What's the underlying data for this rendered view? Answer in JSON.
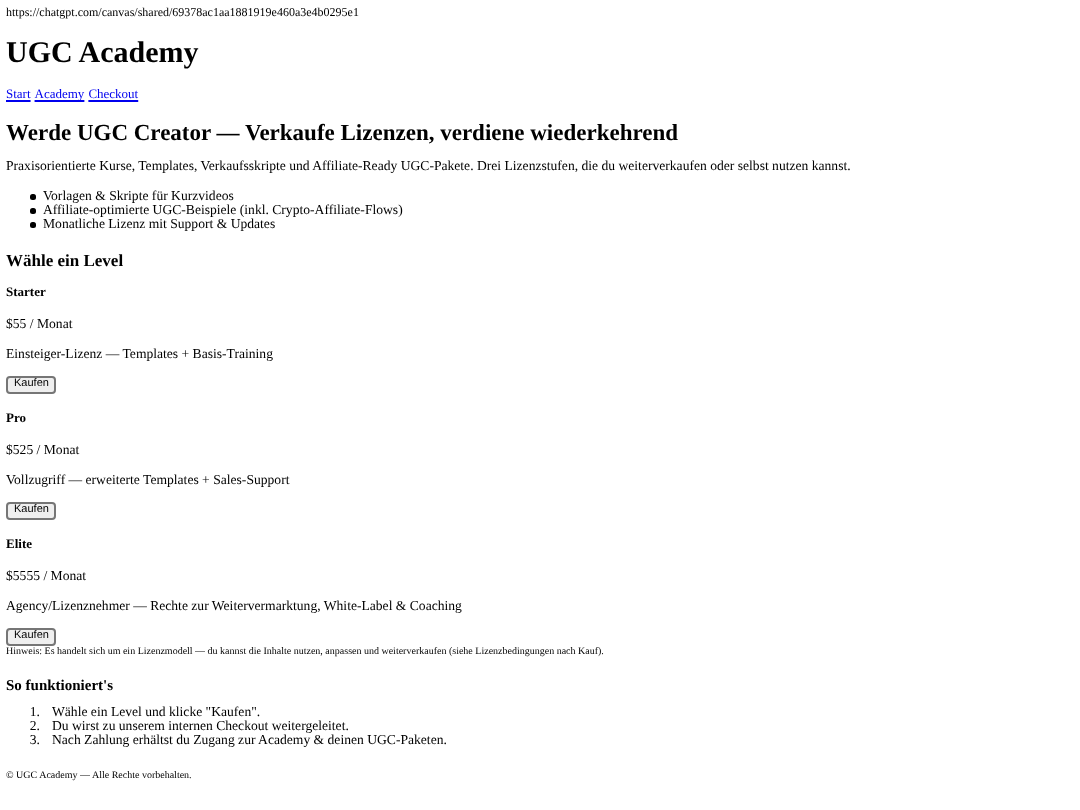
{
  "url": "https://chatgpt.com/canvas/shared/69378ac1aa1881919e460a3e4b0295e1",
  "title": "UGC Academy",
  "nav": [
    {
      "label": "Start"
    },
    {
      "label": "Academy"
    },
    {
      "label": "Checkout"
    }
  ],
  "headline": "Werde UGC Creator — Verkaufe Lizenzen, verdiene wiederkehrend",
  "intro": "Praxisorientierte Kurse, Templates, Verkaufsskripte und Affiliate-Ready UGC-Pakete. Drei Lizenzstufen, die du weiterverkaufen oder selbst nutzen kannst.",
  "features": [
    "Vorlagen & Skripte für Kurzvideos",
    "Affiliate-optimierte UGC-Beispiele (inkl. Crypto-Affiliate-Flows)",
    "Monatliche Lizenz mit Support & Updates"
  ],
  "level_heading": "Wähle ein Level",
  "tiers": [
    {
      "name": "Starter",
      "price": "$55 / Monat",
      "description": "Einsteiger-Lizenz — Templates + Basis-Training",
      "button": "Kaufen"
    },
    {
      "name": "Pro",
      "price": "$525 / Monat",
      "description": "Vollzugriff — erweiterte Templates + Sales-Support",
      "button": "Kaufen"
    },
    {
      "name": "Elite",
      "price": "$5555 / Monat",
      "description": "Agency/Lizenznehmer — Rechte zur Weitervermarktung, White-Label & Coaching",
      "button": "Kaufen"
    }
  ],
  "note": "Hinweis: Es handelt sich um ein Lizenzmodell — du kannst die Inhalte nutzen, anpassen und weiterverkaufen (siehe Lizenzbedingungen nach Kauf).",
  "how_heading": "So funktioniert's",
  "steps": [
    {
      "number": "1.",
      "text": "Wähle ein Level und klicke \"Kaufen\"."
    },
    {
      "number": "2.",
      "text": "Du wirst zu unserem internen Checkout weitergeleitet."
    },
    {
      "number": "3.",
      "text": "Nach Zahlung erhältst du Zugang zur Academy & deinen UGC-Paketen."
    }
  ],
  "footer": "© UGC Academy — Alle Rechte vorbehalten."
}
